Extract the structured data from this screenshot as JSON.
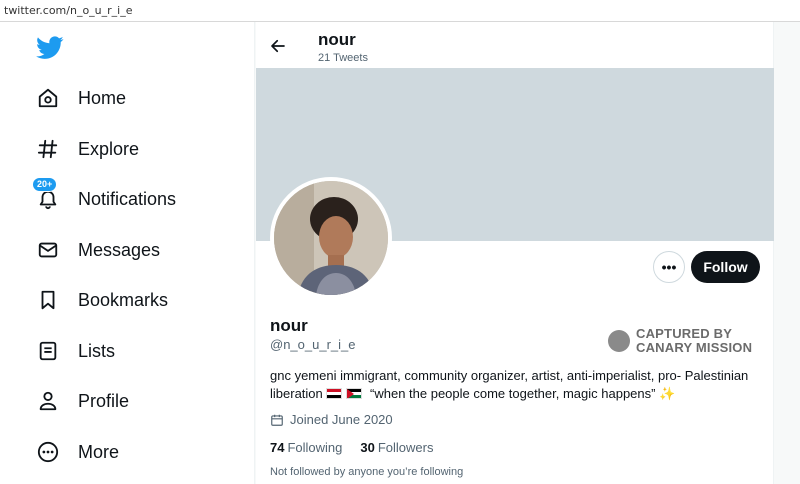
{
  "browser": {
    "url": "twitter.com/n_o_u_r_i_e"
  },
  "sidebar": {
    "items": [
      {
        "label": "Home",
        "icon": "home-icon"
      },
      {
        "label": "Explore",
        "icon": "hashtag-icon"
      },
      {
        "label": "Notifications",
        "icon": "bell-icon",
        "badge": "20+"
      },
      {
        "label": "Messages",
        "icon": "envelope-icon"
      },
      {
        "label": "Bookmarks",
        "icon": "bookmark-icon"
      },
      {
        "label": "Lists",
        "icon": "list-icon"
      },
      {
        "label": "Profile",
        "icon": "user-icon"
      },
      {
        "label": "More",
        "icon": "more-circle-icon"
      }
    ]
  },
  "header": {
    "name": "nour",
    "tweet_count": "21 Tweets"
  },
  "profile": {
    "name": "nour",
    "handle": "@n_o_u_r_i_e",
    "bio_line1": "gnc yemeni immigrant, community organizer, artist, anti-imperialist, pro- Palestinian",
    "bio_line2_prefix": "liberation",
    "bio_line2_quote": "“when the people come together, magic happens”",
    "sparkle": "✨",
    "joined": "Joined June 2020",
    "following_count": "74",
    "following_label": "Following",
    "followers_count": "30",
    "followers_label": "Followers",
    "not_followed": "Not followed by anyone you’re following"
  },
  "actions": {
    "more": "•••",
    "follow": "Follow"
  },
  "watermark": {
    "line1": "CAPTURED BY",
    "line2": "CANARY MISSION"
  },
  "colors": {
    "accent": "#1d9bf0",
    "banner": "#cfd9de",
    "follow_bg": "#0f1419"
  }
}
